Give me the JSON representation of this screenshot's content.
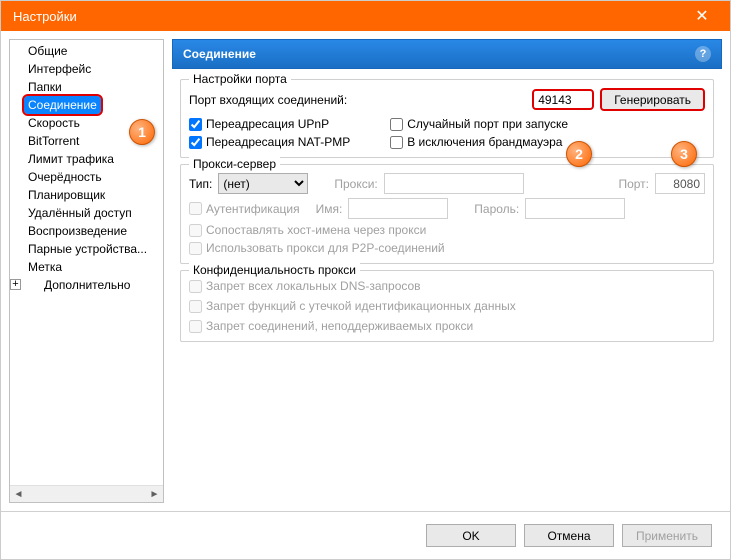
{
  "window": {
    "title": "Настройки"
  },
  "sidebar": {
    "items": [
      "Общие",
      "Интерфейс",
      "Папки",
      "Соединение",
      "Скорость",
      "BitTorrent",
      "Лимит трафика",
      "Очерёдность",
      "Планировщик",
      "Удалённый доступ",
      "Воспроизведение",
      "Парные устройства...",
      "Метка"
    ],
    "last": "Дополнительно",
    "selected_index": 3,
    "expand_symbol": "+"
  },
  "panel": {
    "title": "Соединение",
    "help": "?"
  },
  "port_settings": {
    "legend": "Настройки порта",
    "incoming_label": "Порт входящих соединений:",
    "port_value": "49143",
    "generate_btn": "Генерировать",
    "upnp": "Переадресация UPnP",
    "natpmp": "Переадресация NAT-PMP",
    "random": "Случайный порт при запуске",
    "firewall": "В исключения брандмауэра"
  },
  "proxy": {
    "legend": "Прокси-сервер",
    "type_label": "Тип:",
    "type_value": "(нет)",
    "proxy_label": "Прокси:",
    "port_label": "Порт:",
    "port_value": "8080",
    "auth": "Аутентификация",
    "name_label": "Имя:",
    "pass_label": "Пароль:",
    "hostnames": "Сопоставлять хост-имена через прокси",
    "p2p": "Использовать прокси для P2P-соединений"
  },
  "privacy": {
    "legend": "Конфиденциальность прокси",
    "dns": "Запрет всех локальных DNS-запросов",
    "leak": "Запрет функций с утечкой идентификационных данных",
    "unsupported": "Запрет соединений, неподдерживаемых прокси"
  },
  "footer": {
    "ok": "OK",
    "cancel": "Отмена",
    "apply": "Применить"
  },
  "annotations": {
    "a1": "1",
    "a2": "2",
    "a3": "3"
  }
}
